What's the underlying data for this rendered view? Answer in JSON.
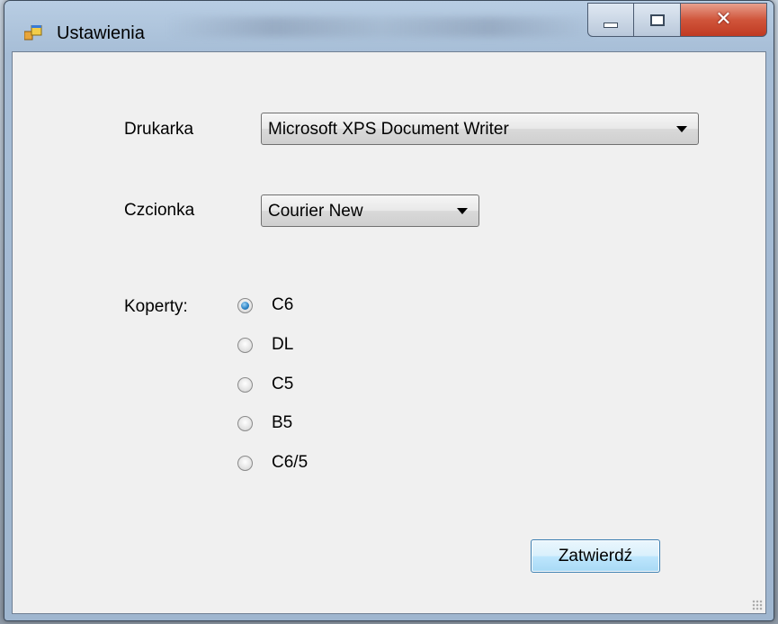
{
  "window": {
    "title": "Ustawienia",
    "controls": {
      "minimize": "minimize",
      "maximize": "maximize",
      "close": "close"
    },
    "close_color": "#c8412a",
    "icon": "app-window-icon"
  },
  "form": {
    "printer_label": "Drukarka",
    "printer_value": "Microsoft XPS Document Writer",
    "font_label": "Czcionka",
    "font_value": "Courier New",
    "envelopes_label": "Koperty:",
    "envelopes": [
      {
        "label": "C6",
        "checked": true
      },
      {
        "label": "DL",
        "checked": false
      },
      {
        "label": "C5",
        "checked": false
      },
      {
        "label": "B5",
        "checked": false
      },
      {
        "label": "C6/5",
        "checked": false
      }
    ],
    "submit_label": "Zatwierdź"
  }
}
